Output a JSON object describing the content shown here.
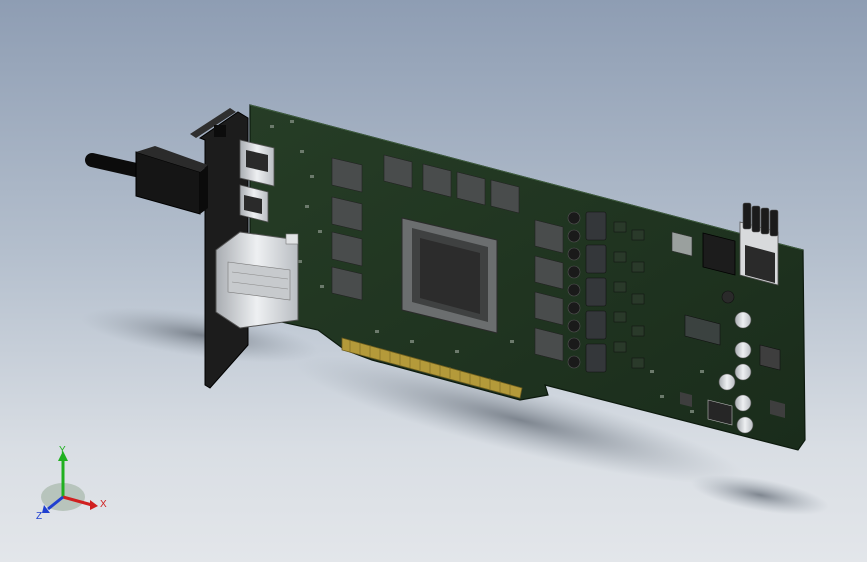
{
  "viewport": {
    "background_top": "#8e9db3",
    "background_bottom": "#e3e6ea"
  },
  "model": {
    "subject": "pcie-graphics-card-assembly",
    "pcb_color": "#1f3420",
    "bracket_color": "#1c1c1c",
    "connector_color": "#d5d8dc",
    "gpu_die_color": "#2c2c2c",
    "memory_chip_count": 12
  },
  "triad": {
    "x_label": "X",
    "y_label": "Y",
    "z_label": "Z",
    "x_color": "#d02020",
    "y_color": "#20b020",
    "z_color": "#2040d0"
  }
}
